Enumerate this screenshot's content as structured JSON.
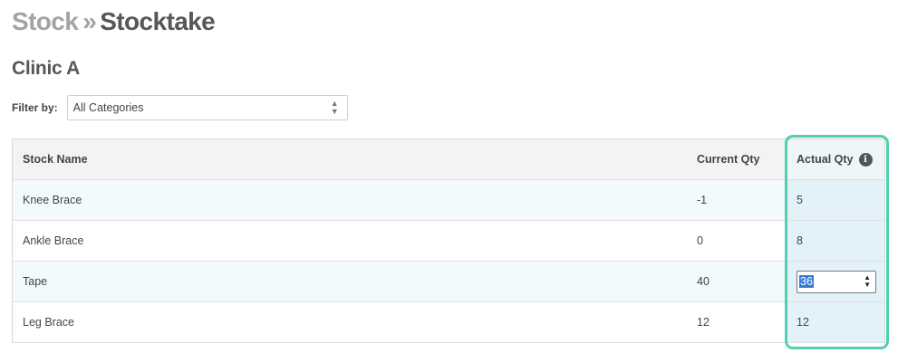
{
  "breadcrumb": {
    "parent": "Stock",
    "separator": "»",
    "current": "Stocktake"
  },
  "location": "Clinic A",
  "filter": {
    "label": "Filter by:",
    "selected": "All Categories"
  },
  "table": {
    "headers": {
      "name": "Stock Name",
      "current": "Current Qty",
      "actual": "Actual Qty"
    },
    "rows": [
      {
        "name": "Knee Brace",
        "current": "-1",
        "actual": "5"
      },
      {
        "name": "Ankle Brace",
        "current": "0",
        "actual": "8"
      },
      {
        "name": "Tape",
        "current": "40",
        "actual": "36"
      },
      {
        "name": "Leg Brace",
        "current": "12",
        "actual": "12"
      }
    ]
  },
  "icons": {
    "info": "info-icon",
    "select_arrows": "chevron-up-down-icon",
    "stepper": "spinner-icon"
  },
  "colors": {
    "highlight": "#4fd0b0",
    "selection": "#3a78d6",
    "actual_column": "#e3f2f8"
  }
}
